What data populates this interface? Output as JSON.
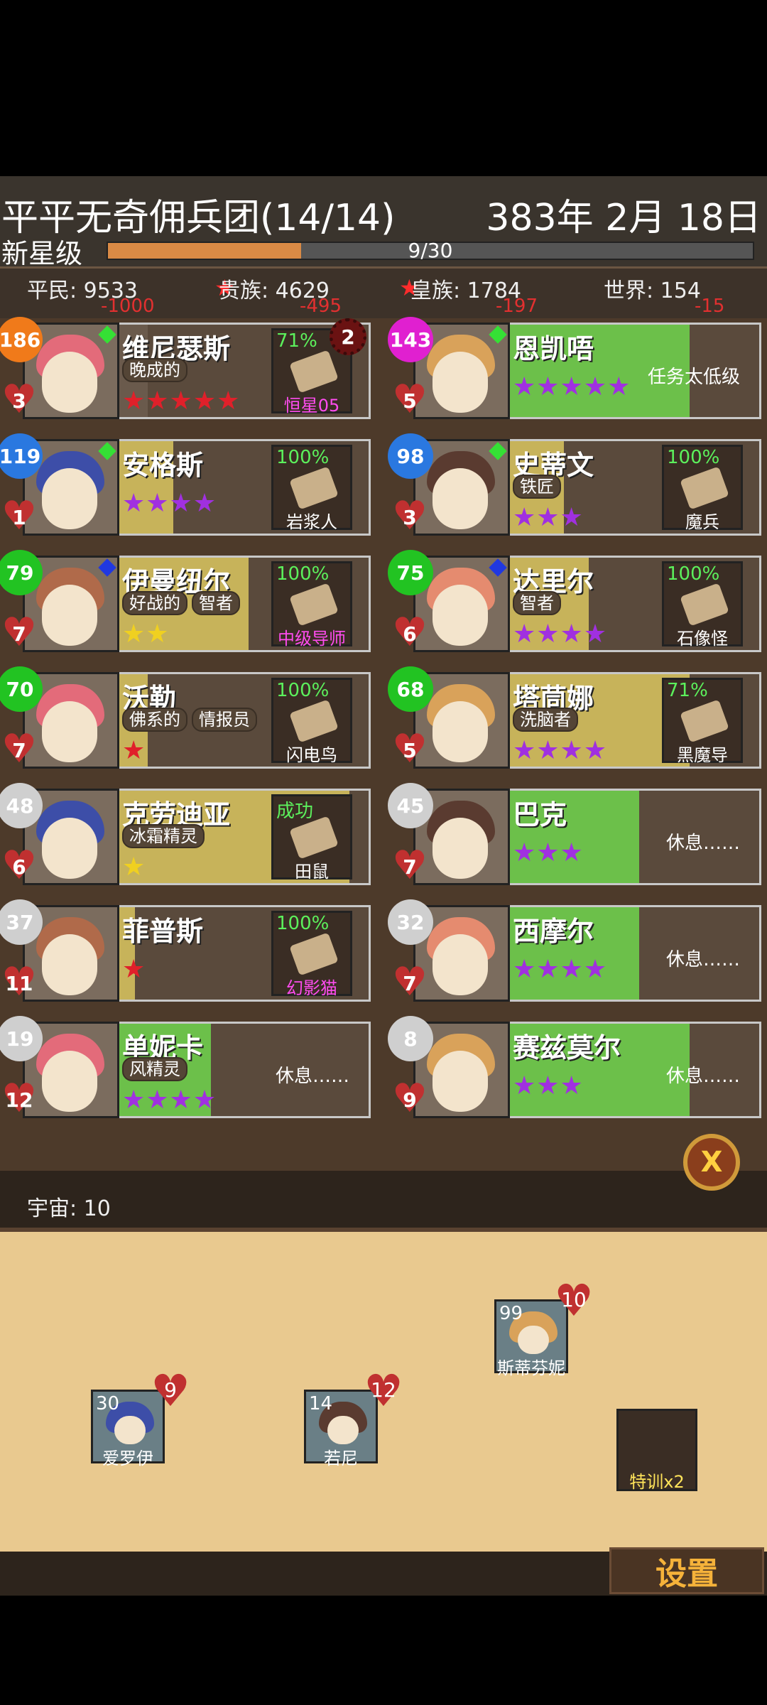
{
  "header": {
    "title": "平平无奇佣兵团(14/14)",
    "date": "383年 2月 18日",
    "rank": "新星级",
    "progress_text": "9/30",
    "progress_fraction": 0.3
  },
  "stats": [
    {
      "label": "平民: 9533",
      "diff": "-1000"
    },
    {
      "label": "贵族: 4629",
      "diff": "-495"
    },
    {
      "label": "皇族: 1784",
      "diff": "-197"
    },
    {
      "label": "世界: 154",
      "diff": "-15"
    }
  ],
  "roster": [
    {
      "name": "维尼瑟斯",
      "level": "186",
      "hp": "3",
      "traits": [
        "晚成的"
      ],
      "stars": "★★★★★",
      "star_color": "#e0202a",
      "task": {
        "pct": "71%",
        "name": "恒星05",
        "name_color": "#ff4cf0"
      },
      "rest": "",
      "progress_color": "#6a5a4c",
      "progress_fraction": 0.2,
      "level_color": "#f07a1a",
      "gem_color": "#35e035",
      "badge": "2"
    },
    {
      "name": "恩凯唔",
      "level": "143",
      "hp": "5",
      "traits": [],
      "stars": "★★★★★",
      "star_color": "#a030e0",
      "task": null,
      "rest": "任务太低级",
      "progress_color": "#6cc04a",
      "progress_fraction": 0.8,
      "level_color": "#e020d0",
      "gem_color": "#35e035",
      "badge": ""
    },
    {
      "name": "安格斯",
      "level": "119",
      "hp": "1",
      "traits": [],
      "stars": "★★★★",
      "star_color": "#a030e0",
      "task": {
        "pct": "100%",
        "name": "岩浆人",
        "name_color": "#ffffff"
      },
      "rest": "",
      "progress_color": "#c7b35a",
      "progress_fraction": 0.3,
      "level_color": "#2a78e0",
      "gem_color": "#35e035",
      "badge": ""
    },
    {
      "name": "史蒂文",
      "level": "98",
      "hp": "3",
      "traits": [
        "铁匠"
      ],
      "stars": "★★★",
      "star_color": "#a030e0",
      "task": {
        "pct": "100%",
        "name": "魔兵",
        "name_color": "#ffffff"
      },
      "rest": "",
      "progress_color": "#c7b35a",
      "progress_fraction": 0.3,
      "level_color": "#2a78e0",
      "gem_color": "#35e035",
      "badge": ""
    },
    {
      "name": "伊曼纽尔",
      "level": "79",
      "hp": "7",
      "traits": [
        "好战的",
        "智者"
      ],
      "stars": "★★",
      "star_color": "#f0d020",
      "task": {
        "pct": "100%",
        "name": "中级导师",
        "name_color": "#ff4cf0"
      },
      "rest": "",
      "progress_color": "#c7b35a",
      "progress_fraction": 0.6,
      "level_color": "#22c322",
      "gem_color": "#2038e0",
      "badge": ""
    },
    {
      "name": "达里尔",
      "level": "75",
      "hp": "6",
      "traits": [
        "智者"
      ],
      "stars": "★★★★",
      "star_color": "#a030e0",
      "task": {
        "pct": "100%",
        "name": "石像怪",
        "name_color": "#ffffff"
      },
      "rest": "",
      "progress_color": "#c7b35a",
      "progress_fraction": 0.4,
      "level_color": "#22c322",
      "gem_color": "#2038e0",
      "badge": ""
    },
    {
      "name": "沃勒",
      "level": "70",
      "hp": "7",
      "traits": [
        "佛系的",
        "情报员"
      ],
      "stars": "★",
      "star_color": "#e0202a",
      "task": {
        "pct": "100%",
        "name": "闪电鸟",
        "name_color": "#ffffff"
      },
      "rest": "",
      "progress_color": "#c7b35a",
      "progress_fraction": 0.2,
      "level_color": "#22c322",
      "gem_color": "",
      "badge": ""
    },
    {
      "name": "塔茼娜",
      "level": "68",
      "hp": "5",
      "traits": [
        "洗脑者"
      ],
      "stars": "★★★★",
      "star_color": "#a030e0",
      "task": {
        "pct": "71%",
        "name": "黑魔导",
        "name_color": "#ffffff"
      },
      "rest": "",
      "progress_color": "#c7b35a",
      "progress_fraction": 0.8,
      "level_color": "#22c322",
      "gem_color": "",
      "badge": ""
    },
    {
      "name": "克劳迪亚",
      "level": "48",
      "hp": "6",
      "traits": [
        "冰霜精灵"
      ],
      "stars": "★",
      "star_color": "#f0d020",
      "task": {
        "pct": "成功",
        "name": "田鼠",
        "name_color": "#ffffff"
      },
      "rest": "",
      "progress_color": "#c7b35a",
      "progress_fraction": 1.0,
      "level_color": "#cfcfcf",
      "gem_color": "",
      "badge": ""
    },
    {
      "name": "巴克",
      "level": "45",
      "hp": "7",
      "traits": [],
      "stars": "★★★",
      "star_color": "#a030e0",
      "task": null,
      "rest": "休息……",
      "progress_color": "#6cc04a",
      "progress_fraction": 0.6,
      "level_color": "#cfcfcf",
      "gem_color": "",
      "badge": ""
    },
    {
      "name": "菲普斯",
      "level": "37",
      "hp": "11",
      "traits": [],
      "stars": "★",
      "star_color": "#e0202a",
      "task": {
        "pct": "100%",
        "name": "幻影猫",
        "name_color": "#ff4cf0"
      },
      "rest": "",
      "progress_color": "#c7b35a",
      "progress_fraction": 0.15,
      "level_color": "#cfcfcf",
      "gem_color": "",
      "badge": ""
    },
    {
      "name": "西摩尔",
      "level": "32",
      "hp": "7",
      "traits": [],
      "stars": "★★★★",
      "star_color": "#a030e0",
      "task": null,
      "rest": "休息……",
      "progress_color": "#6cc04a",
      "progress_fraction": 0.6,
      "level_color": "#cfcfcf",
      "gem_color": "",
      "badge": ""
    },
    {
      "name": "单妮卡",
      "level": "19",
      "hp": "12",
      "traits": [
        "风精灵"
      ],
      "stars": "★★★★",
      "star_color": "#a030e0",
      "task": null,
      "rest": "休息……",
      "progress_color": "#6cc04a",
      "progress_fraction": 0.45,
      "level_color": "#cfcfcf",
      "gem_color": "",
      "badge": ""
    },
    {
      "name": "赛兹莫尔",
      "level": "8",
      "hp": "9",
      "traits": [],
      "stars": "★★★",
      "star_color": "#a030e0",
      "task": null,
      "rest": "休息……",
      "progress_color": "#6cc04a",
      "progress_fraction": 0.8,
      "level_color": "#cfcfcf",
      "gem_color": "",
      "badge": ""
    }
  ],
  "universe": "宇宙: 10",
  "board_units": [
    {
      "name": "斯蒂芬妮",
      "level": "99",
      "hp": "10"
    },
    {
      "name": "爱罗伊",
      "level": "30",
      "hp": "9"
    },
    {
      "name": "若尼",
      "level": "14",
      "hp": "12"
    }
  ],
  "special": "特训x2",
  "close_symbol": "X",
  "settings_label": "设置",
  "colors": {
    "hair": [
      "#e36b7a",
      "#d9a25a",
      "#3d4ea8",
      "#5a3b30",
      "#b06a4a",
      "#e58b6f"
    ]
  }
}
